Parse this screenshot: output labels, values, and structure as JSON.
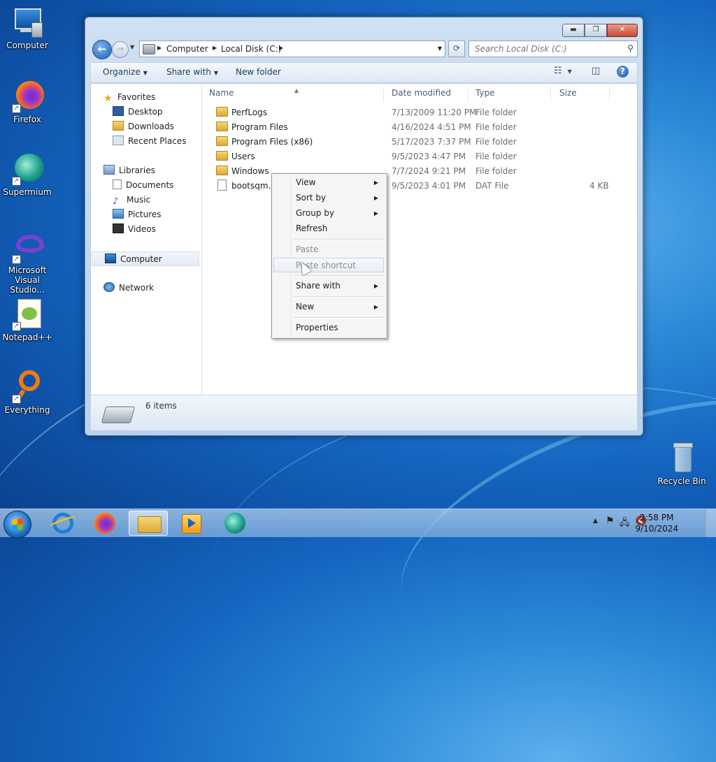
{
  "desktop": {
    "icons": [
      {
        "label": "Computer"
      },
      {
        "label": "Firefox"
      },
      {
        "label": "Supermium"
      },
      {
        "label": "Microsoft Visual Studio..."
      },
      {
        "label": "Notepad++"
      },
      {
        "label": "Everything"
      },
      {
        "label": "Recycle Bin"
      }
    ]
  },
  "window": {
    "address": {
      "crumbs": [
        "Computer",
        "Local Disk (C:)"
      ]
    },
    "search": {
      "placeholder": "Search Local Disk (C:)"
    },
    "toolbar": {
      "organize": "Organize",
      "share_with": "Share with",
      "new_folder": "New folder"
    },
    "nav": {
      "favorites": "Favorites",
      "desktop": "Desktop",
      "downloads": "Downloads",
      "recent_places": "Recent Places",
      "libraries": "Libraries",
      "documents": "Documents",
      "music": "Music",
      "pictures": "Pictures",
      "videos": "Videos",
      "computer": "Computer",
      "network": "Network"
    },
    "columns": {
      "name": "Name",
      "date": "Date modified",
      "type": "Type",
      "size": "Size"
    },
    "files": [
      {
        "name": "PerfLogs",
        "date": "7/13/2009 11:20 PM",
        "type": "File folder",
        "size": ""
      },
      {
        "name": "Program Files",
        "date": "4/16/2024 4:51 PM",
        "type": "File folder",
        "size": ""
      },
      {
        "name": "Program Files (x86)",
        "date": "5/17/2023 7:37 PM",
        "type": "File folder",
        "size": ""
      },
      {
        "name": "Users",
        "date": "9/5/2023 4:47 PM",
        "type": "File folder",
        "size": ""
      },
      {
        "name": "Windows",
        "date": "7/7/2024 9:21 PM",
        "type": "File folder",
        "size": ""
      },
      {
        "name": "bootsqm.dat",
        "date": "9/5/2023 4:01 PM",
        "type": "DAT File",
        "size": "4 KB"
      }
    ],
    "status": {
      "item_count": "6 items"
    }
  },
  "context_menu": {
    "items": [
      {
        "label": "View"
      },
      {
        "label": "Sort by"
      },
      {
        "label": "Group by"
      },
      {
        "label": "Refresh"
      },
      {
        "label": "Paste"
      },
      {
        "label": "Paste shortcut"
      },
      {
        "label": "Share with"
      },
      {
        "label": "New"
      },
      {
        "label": "Properties"
      }
    ]
  },
  "taskbar": {
    "clock": {
      "time": "2:58 PM",
      "date": "9/10/2024"
    }
  },
  "colors": {
    "accent": "#1565c0",
    "selection": "#e3ebf4"
  }
}
